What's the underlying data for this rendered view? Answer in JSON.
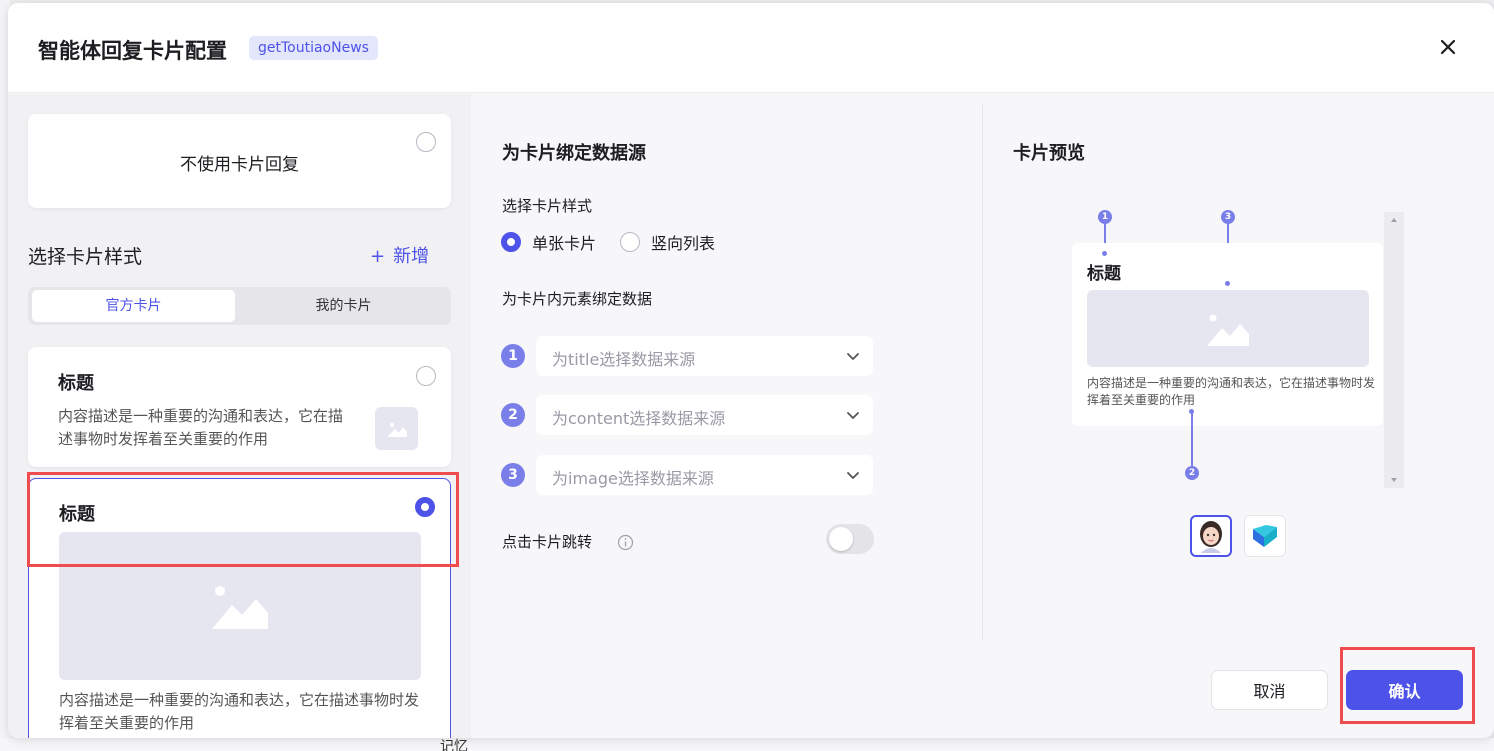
{
  "background": {
    "memory_label": "记忆"
  },
  "header": {
    "title": "智能体回复卡片配置",
    "api_badge": "getToutiaoNews"
  },
  "left": {
    "no_card_label": "不使用卡片回复",
    "section_title": "选择卡片样式",
    "add_label": "新增",
    "tabs": [
      {
        "label": "官方卡片",
        "active": true
      },
      {
        "label": "我的卡片",
        "active": false
      }
    ],
    "cards": [
      {
        "title": "标题",
        "desc": "内容描述是一种重要的沟通和表达，它在描述事物时发挥着至关重要的作用",
        "selected": false
      },
      {
        "title": "标题",
        "desc": "内容描述是一种重要的沟通和表达，它在描述事物时发挥着至关重要的作用",
        "selected": true
      }
    ]
  },
  "middle": {
    "title": "为卡片绑定数据源",
    "style_label": "选择卡片样式",
    "style_options": [
      {
        "label": "单张卡片",
        "selected": true
      },
      {
        "label": "竖向列表",
        "selected": false
      }
    ],
    "bind_label": "为卡片内元素绑定数据",
    "bindings": [
      {
        "num": "1",
        "placeholder": "为title选择数据来源"
      },
      {
        "num": "2",
        "placeholder": "为content选择数据来源"
      },
      {
        "num": "3",
        "placeholder": "为image选择数据来源"
      }
    ],
    "jump_label": "点击卡片跳转",
    "jump_enabled": false
  },
  "preview": {
    "title": "卡片预览",
    "card_title": "标题",
    "card_desc": "内容描述是一种重要的沟通和表达，它在描述事物时发挥着至关重要的作用",
    "pins": [
      "1",
      "2",
      "3"
    ]
  },
  "footer": {
    "cancel_label": "取消",
    "confirm_label": "确认"
  },
  "colors": {
    "accent": "#4d53e8",
    "highlight": "#f04b4f",
    "pin": "#7a7ee8"
  }
}
